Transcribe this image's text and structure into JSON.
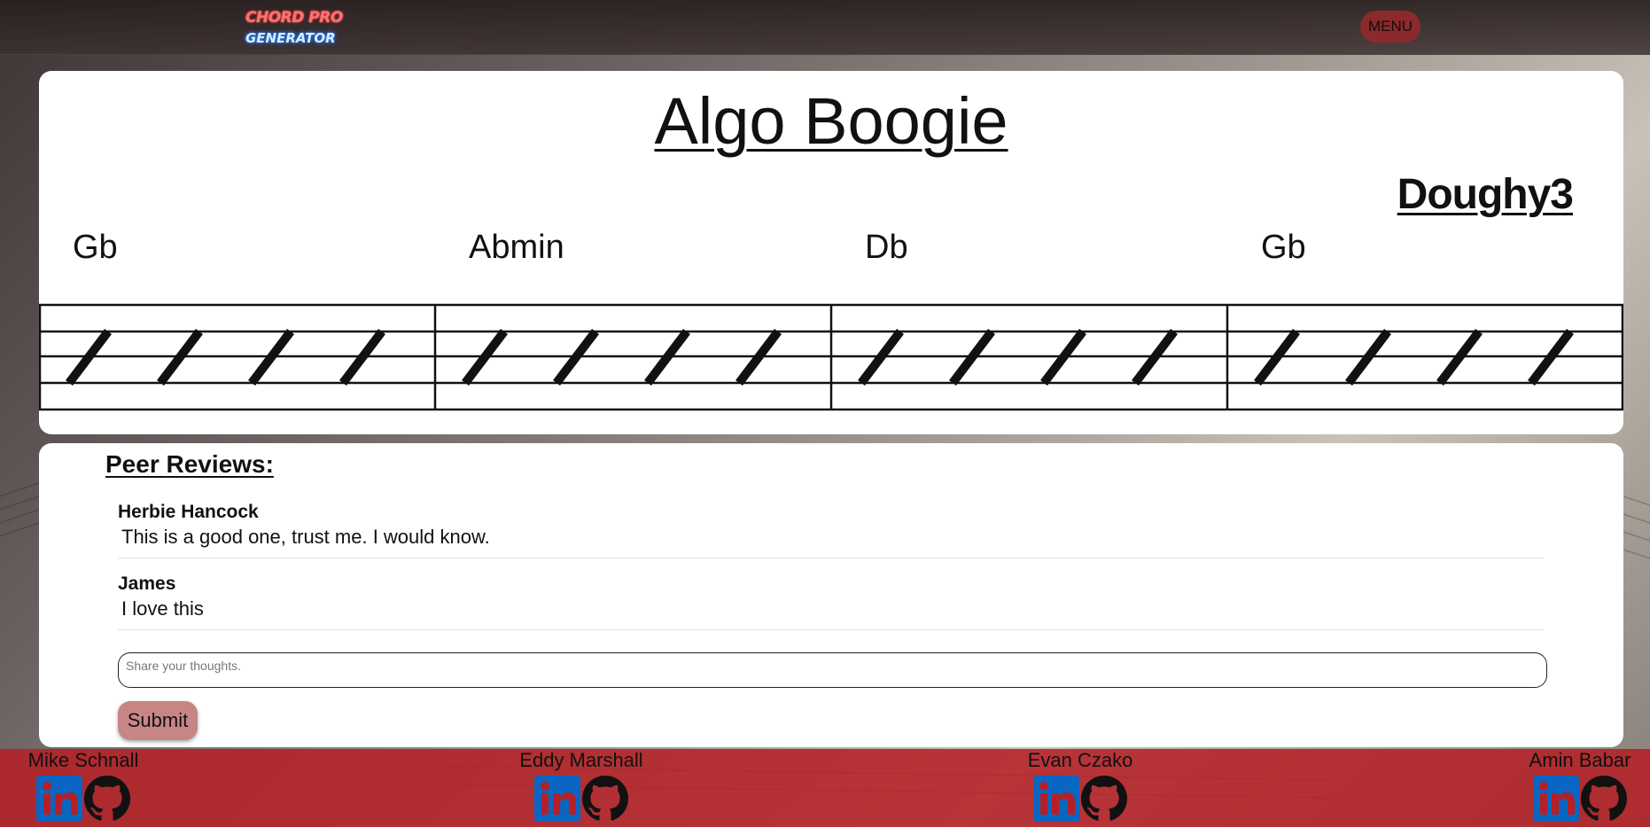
{
  "nav": {
    "logo_line1": "CHORD PRO",
    "logo_line2": "GENERATOR",
    "menu_label": "MENU"
  },
  "song": {
    "title": "Algo Boogie",
    "author": "Doughy3",
    "chords": [
      "Gb",
      "Abmin",
      "Db",
      "Gb"
    ],
    "beats_per_measure": 4
  },
  "reviews": {
    "heading": "Peer Reviews:",
    "items": [
      {
        "name": "Herbie Hancock",
        "text": "This is a good one, trust me. I would know."
      },
      {
        "name": "James",
        "text": "I love this"
      }
    ],
    "input_placeholder": "Share your thoughts.",
    "submit_label": "Submit"
  },
  "footer": {
    "members": [
      {
        "name": "Mike Schnall",
        "icons": [
          "linkedin-icon",
          "github-icon"
        ]
      },
      {
        "name": "Eddy Marshall",
        "icons": [
          "linkedin-icon",
          "github-icon"
        ]
      },
      {
        "name": "Evan Czako",
        "icons": [
          "linkedin-icon",
          "github-icon"
        ]
      },
      {
        "name": "Amin Babar",
        "icons": [
          "linkedin-icon",
          "github-icon"
        ]
      }
    ]
  },
  "colors": {
    "menu_button": "#8b2a2d",
    "submit_button": "#c88585",
    "footer": "#b42026",
    "linkedin": "#0a66c2"
  }
}
